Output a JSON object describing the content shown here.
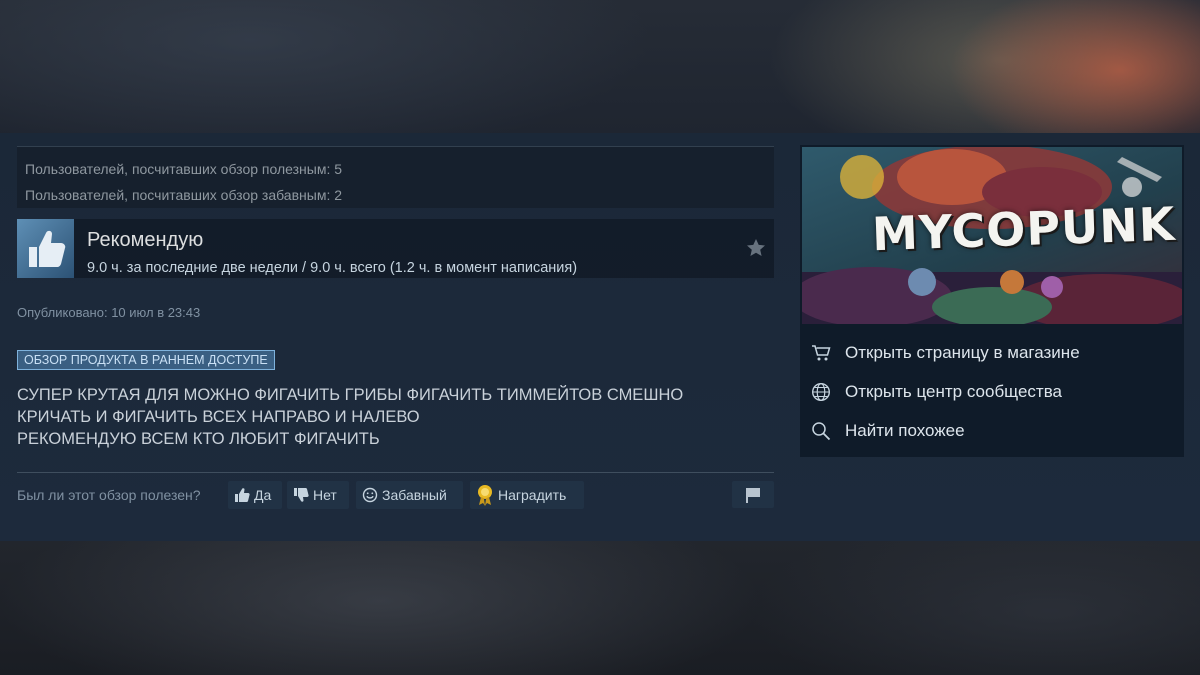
{
  "stats": {
    "helpful": "Пользователей, посчитавших обзор полезным: 5",
    "funny": "Пользователей, посчитавших обзор забавным: 2"
  },
  "recommendation": {
    "title": "Рекомендую",
    "hours": "9.0 ч. за последние две недели / 9.0 ч. всего (1.2 ч. в момент написания)"
  },
  "posted": "Опубликовано: 10 июл в 23:43",
  "early_access_badge": "ОБЗОР ПРОДУКТА В РАННЕМ ДОСТУПЕ",
  "review_lines": [
    "СУПЕР КРУТАЯ ДЛЯ МОЖНО ФИГАЧИТЬ ГРИБЫ ФИГАЧИТЬ ТИММЕЙТОВ СМЕШНО",
    "КРИЧАТЬ И ФИГАЧИТЬ ВСЕХ НАПРАВО И НАЛЕВО",
    "РЕКОМЕНДУЮ ВСЕМ КТО ЛЮБИТ ФИГАЧИТЬ"
  ],
  "voting": {
    "question": "Был ли этот обзор полезен?",
    "yes": "Да",
    "no": "Нет",
    "funny": "Забавный",
    "award": "Наградить"
  },
  "game": {
    "logo": "MYCOPUNK",
    "links": [
      {
        "label": "Открыть страницу в магазине",
        "icon": "cart-icon"
      },
      {
        "label": "Открыть центр сообщества",
        "icon": "globe-icon"
      },
      {
        "label": "Найти похожее",
        "icon": "search-icon"
      }
    ]
  },
  "colors": {
    "accent_blue": "#66c0f4",
    "badge_bg": "#3a5f82",
    "award_gold": "#e8b923"
  }
}
